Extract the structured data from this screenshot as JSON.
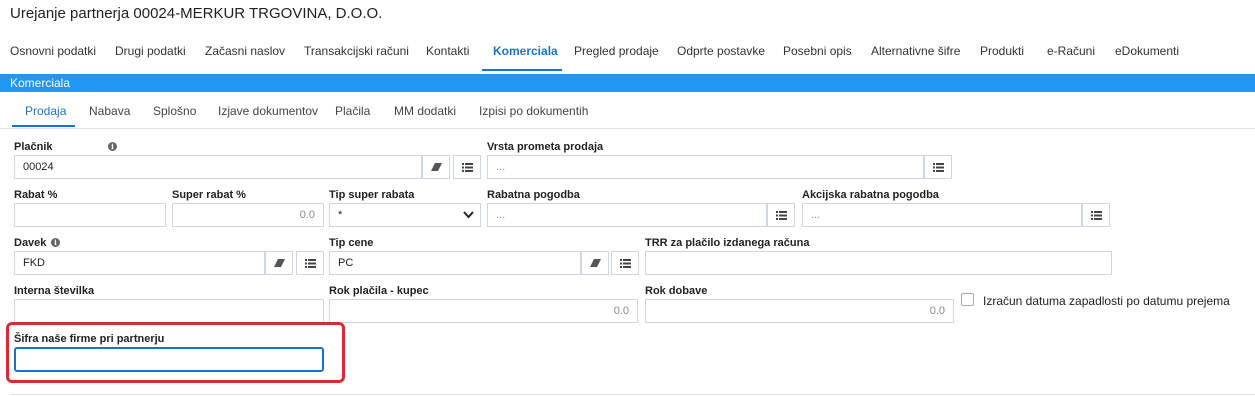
{
  "page": {
    "title": "Urejanje partnerja 00024-MERKUR TRGOVINA, D.O.O."
  },
  "main_tabs": [
    {
      "label": "Osnovni podatki"
    },
    {
      "label": "Drugi podatki"
    },
    {
      "label": "Začasni naslov"
    },
    {
      "label": "Transakcijski računi"
    },
    {
      "label": "Kontakti"
    },
    {
      "label": "Komerciala"
    },
    {
      "label": "Pregled prodaje"
    },
    {
      "label": "Odprte postavke"
    },
    {
      "label": "Posebni opis"
    },
    {
      "label": "Alternativne šifre"
    },
    {
      "label": "Produkti"
    },
    {
      "label": "e-Računi"
    },
    {
      "label": "eDokumenti"
    }
  ],
  "active_main_tab": "Komerciala",
  "section": {
    "title": "Komerciala"
  },
  "sub_tabs": [
    {
      "label": "Prodaja"
    },
    {
      "label": "Nabava"
    },
    {
      "label": "Splošno"
    },
    {
      "label": "Izjave dokumentov"
    },
    {
      "label": "Plačila"
    },
    {
      "label": "MM dodatki"
    },
    {
      "label": "Izpisi po dokumentih"
    }
  ],
  "active_sub_tab": "Prodaja",
  "form": {
    "placnik": {
      "label": "Plačnik",
      "value": "00024"
    },
    "vrsta_prometa": {
      "label": "Vrsta prometa prodaja",
      "placeholder": "..."
    },
    "rabat": {
      "label": "Rabat %",
      "value": ""
    },
    "super_rabat": {
      "label": "Super rabat %",
      "value": "0.0"
    },
    "tip_super_rabata": {
      "label": "Tip super rabata",
      "value": "*"
    },
    "rabatna_pogodba": {
      "label": "Rabatna pogodba",
      "placeholder": "..."
    },
    "akcijska_pogodba": {
      "label": "Akcijska rabatna pogodba",
      "placeholder": "..."
    },
    "davek": {
      "label": "Davek",
      "value": "FKD"
    },
    "tip_cene": {
      "label": "Tip cene",
      "value": "PC"
    },
    "trr": {
      "label": "TRR za plačilo izdanega računa",
      "value": ""
    },
    "interna": {
      "label": "Interna številka",
      "value": ""
    },
    "rok_placila": {
      "label": "Rok plačila - kupec",
      "value": "0.0"
    },
    "rok_dobave": {
      "label": "Rok dobave",
      "value": "0.0"
    },
    "izracun": {
      "label": "Izračun datuma zapadlosti po datumu prejema",
      "checked": false
    },
    "sifra_nase_firme": {
      "label": "Šifra naše firme pri partnerju",
      "value": ""
    }
  },
  "colors": {
    "accent": "#1a73c8",
    "section_bar": "#2196f3",
    "highlight": "#d32f2f"
  }
}
